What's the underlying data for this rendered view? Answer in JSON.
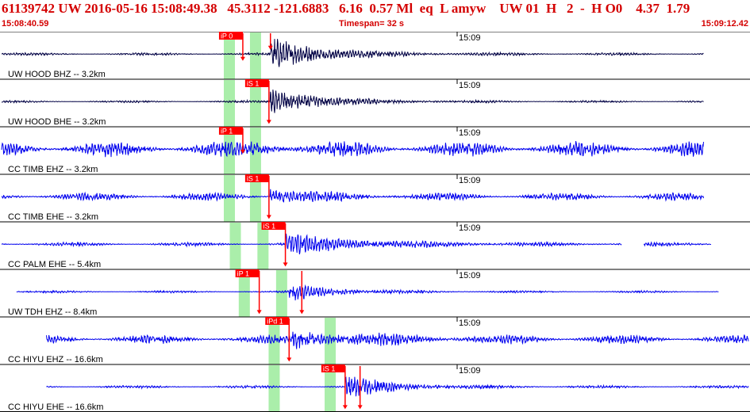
{
  "header": {
    "event_line": "61139742 UW 2016-05-16 15:08:49.38   45.3112 -121.6883   6.16  0.57 Ml  eq  L amyw    UW 01  H   2  -  H O0    4.37  1.79",
    "start_time": "15:08:40.59",
    "timespan": "Timespan=  32 s",
    "end_time": "15:09:12.42"
  },
  "colors": {
    "header_text": "#d40000",
    "trace_blue": "#0000ee",
    "trace_black": "#000044",
    "window_green": "#aaeeaa",
    "pick_red": "#ff0000"
  },
  "time_marker_label": "15:09",
  "channels": [
    {
      "label": "UW HOOD BHZ -- 3.2km",
      "color": "black",
      "amp": 0.09,
      "noise": 0.05,
      "start": 0.0,
      "end": 0.94,
      "gap": null,
      "onset": 0.36,
      "burst": 0.55,
      "decay": 0.07,
      "pick": {
        "label": "iP 0",
        "t": 0.323
      },
      "windows": [
        0.305,
        0.34
      ],
      "marks": [
        {
          "t": 0.323,
          "h": 0.55
        },
        {
          "t": 0.36,
          "h": 0.3
        }
      ]
    },
    {
      "label": "UW HOOD BHE -- 3.2km",
      "color": "black",
      "amp": 0.06,
      "noise": 0.04,
      "start": 0.0,
      "end": 0.94,
      "gap": null,
      "onset": 0.36,
      "burst": 0.45,
      "decay": 0.07,
      "pick": {
        "label": "iS 1",
        "t": 0.358
      },
      "windows": [
        0.305,
        0.34
      ],
      "marks": [
        {
          "t": 0.358,
          "h": 0.9
        }
      ]
    },
    {
      "label": "CC TIMB EHZ -- 3.2km",
      "color": "blue",
      "amp": 0.28,
      "noise": 0.28,
      "start": 0.0,
      "end": 0.94,
      "gap": null,
      "onset": 0.33,
      "burst": 0.1,
      "decay": 0.05,
      "pick": {
        "label": "iP 1",
        "t": 0.323
      },
      "windows": [
        0.305,
        0.34
      ],
      "marks": [
        {
          "t": 0.323,
          "h": 0.5
        }
      ]
    },
    {
      "label": "CC TIMB EHE -- 3.2km",
      "color": "blue",
      "amp": 0.14,
      "noise": 0.14,
      "start": 0.0,
      "end": 0.94,
      "gap": null,
      "onset": 0.36,
      "burst": 0.25,
      "decay": 0.05,
      "pick": {
        "label": "iS 1",
        "t": 0.358
      },
      "windows": [
        0.305,
        0.34
      ],
      "marks": [
        {
          "t": 0.358,
          "h": 0.9
        }
      ]
    },
    {
      "label": "CC PALM EHE -- 5.4km",
      "color": "blue",
      "amp": 0.07,
      "noise": 0.07,
      "start": 0.0,
      "end": 0.95,
      "gap": [
        0.83,
        0.86
      ],
      "onset": 0.38,
      "burst": 0.35,
      "decay": 0.1,
      "pick": {
        "label": "iS 1",
        "t": 0.38
      },
      "windows": [
        0.313,
        0.35
      ],
      "marks": [
        {
          "t": 0.38,
          "h": 0.9
        }
      ]
    },
    {
      "label": "UW TDH EHZ -- 8.4km",
      "color": "blue",
      "amp": 0.04,
      "noise": 0.04,
      "start": 0.02,
      "end": 0.96,
      "gap": null,
      "onset": 0.385,
      "burst": 0.3,
      "decay": 0.06,
      "pick": {
        "label": "iP 1",
        "t": 0.345
      },
      "windows": [
        0.325,
        0.375
      ],
      "marks": [
        {
          "t": 0.345,
          "h": 0.9
        },
        {
          "t": 0.402,
          "h": 0.9
        }
      ]
    },
    {
      "label": "CC HIYU EHZ -- 16.6km",
      "color": "blue",
      "amp": 0.16,
      "noise": 0.16,
      "start": 0.06,
      "end": 1.0,
      "gap": null,
      "onset": 0.39,
      "burst": 0.25,
      "decay": 0.1,
      "pick": {
        "label": "iPd 1",
        "t": 0.385
      },
      "windows": [
        0.365,
        0.44
      ],
      "marks": [
        {
          "t": 0.385,
          "h": 0.9
        }
      ]
    },
    {
      "label": "CC HIYU EHE -- 16.6km",
      "color": "blue",
      "amp": 0.05,
      "noise": 0.05,
      "start": 0.06,
      "end": 1.0,
      "gap": null,
      "onset": 0.46,
      "burst": 0.4,
      "decay": 0.06,
      "pick": {
        "label": "iS 1",
        "t": 0.46
      },
      "windows": [
        0.365,
        0.44
      ],
      "marks": [
        {
          "t": 0.46,
          "h": 0.9
        },
        {
          "t": 0.48,
          "h": 0.9
        }
      ]
    }
  ]
}
